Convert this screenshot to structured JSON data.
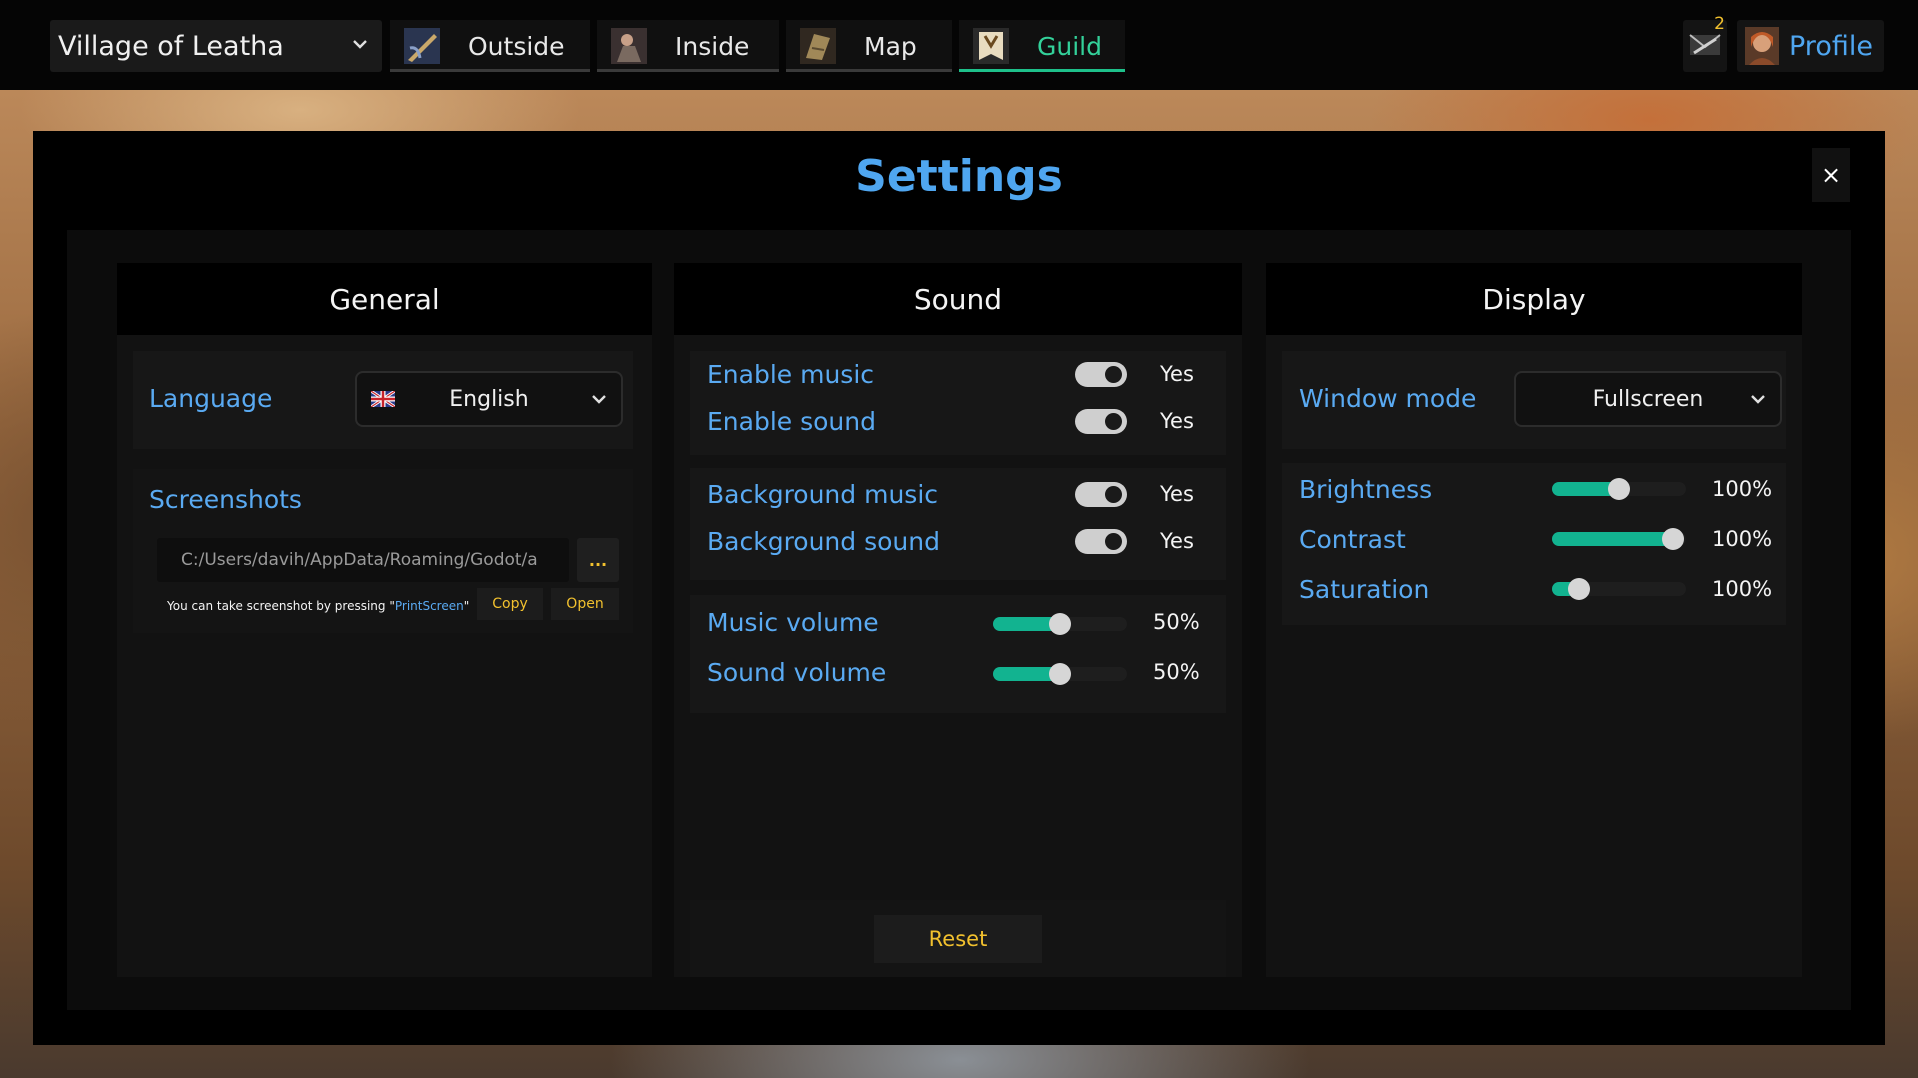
{
  "topbar": {
    "location": "Village of Leatha",
    "tabs": [
      {
        "label": "Outside",
        "icon": "outside-icon"
      },
      {
        "label": "Inside",
        "icon": "inside-icon"
      },
      {
        "label": "Map",
        "icon": "map-icon"
      },
      {
        "label": "Guild",
        "icon": "guild-icon",
        "active": true
      }
    ],
    "notification_count": "2",
    "profile_label": "Profile"
  },
  "settings": {
    "title": "Settings",
    "close_label": "×",
    "general": {
      "header": "General",
      "language_label": "Language",
      "language_value": "English",
      "language_flag": "uk-flag-icon",
      "screenshots_label": "Screenshots",
      "screenshot_path": "C:/Users/davih/AppData/Roaming/Godot/a",
      "browse_label": "...",
      "hint_prefix": "You can take screenshot by pressing \"",
      "hint_key": "PrintScreen",
      "hint_suffix": "\"",
      "copy_label": "Copy",
      "open_label": "Open"
    },
    "sound": {
      "header": "Sound",
      "enable_music_label": "Enable music",
      "enable_music_value": "Yes",
      "enable_sound_label": "Enable sound",
      "enable_sound_value": "Yes",
      "background_music_label": "Background music",
      "background_music_value": "Yes",
      "background_sound_label": "Background sound",
      "background_sound_value": "Yes",
      "music_volume_label": "Music volume",
      "music_volume_value": "50%",
      "music_volume_level": 0.5,
      "sound_volume_label": "Sound volume",
      "sound_volume_value": "50%",
      "sound_volume_level": 0.5,
      "reset_label": "Reset"
    },
    "display": {
      "header": "Display",
      "window_mode_label": "Window mode",
      "window_mode_value": "Fullscreen",
      "brightness_label": "Brightness",
      "brightness_value": "100%",
      "brightness_level": 0.5,
      "contrast_label": "Contrast",
      "contrast_value": "100%",
      "contrast_level": 0.9,
      "saturation_label": "Saturation",
      "saturation_value": "100%",
      "saturation_level": 0.2
    }
  },
  "colors": {
    "accent_blue": "#5aaaf2",
    "accent_green": "#12b390",
    "accent_gold": "#f2c12e"
  }
}
